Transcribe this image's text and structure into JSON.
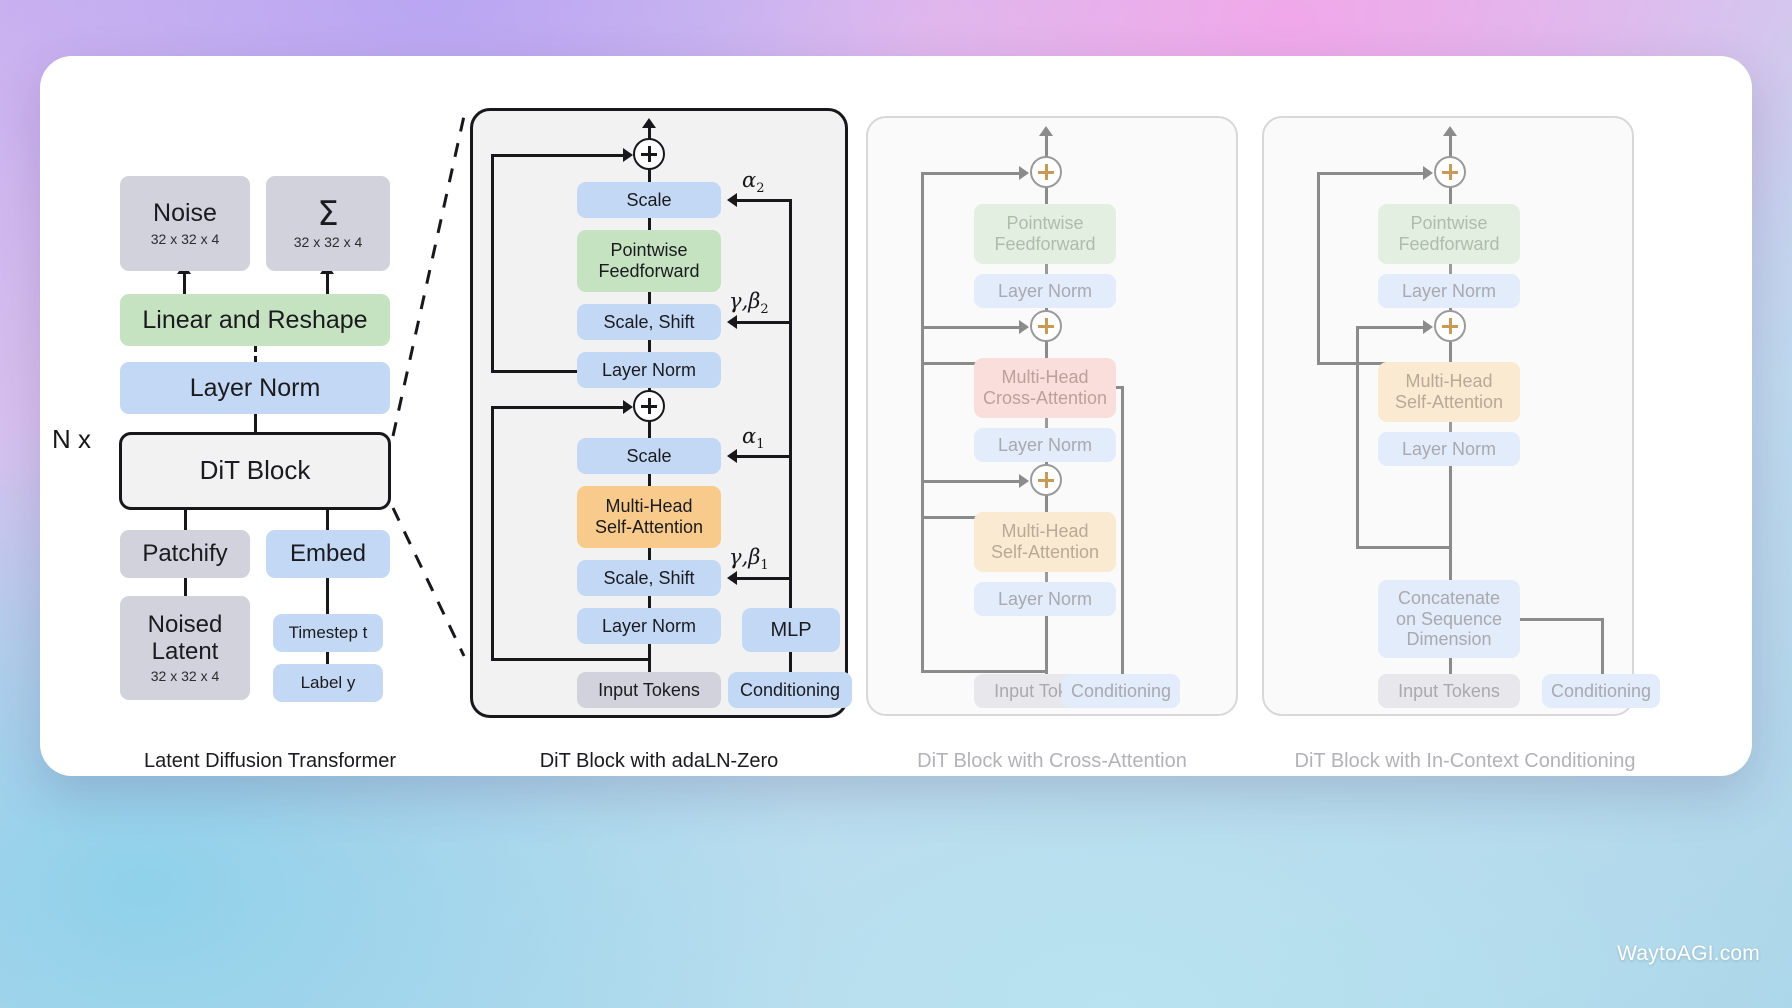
{
  "watermark": "WaytoAGI.com",
  "colors": {
    "grey": "#d2d2dc",
    "blue": "#c3d8f5",
    "green": "#c5e3c0",
    "orange": "#f8cb8c",
    "red": "#f6c8c4",
    "outline": "#18181c",
    "faded_text": "#a9a9b0"
  },
  "panels": [
    {
      "id": "latent-diffusion-transformer",
      "caption": "Latent Diffusion Transformer",
      "repeat_label": "N x",
      "nodes": {
        "noise": "Noise",
        "noise_shape": "32 x 32 x 4",
        "sigma": "Σ",
        "sigma_shape": "32 x 32 x 4",
        "linear_reshape": "Linear and Reshape",
        "layer_norm": "Layer Norm",
        "dit_block": "DiT Block",
        "patchify": "Patchify",
        "embed": "Embed",
        "noised_latent_l1": "Noised",
        "noised_latent_l2": "Latent",
        "noised_latent_shape": "32 x 32 x 4",
        "timestep": "Timestep t",
        "label": "Label y"
      }
    },
    {
      "id": "dit-block-adaln-zero",
      "caption": "DiT Block with adaLN-Zero",
      "nodes": {
        "scale2": "Scale",
        "pointwise_l1": "Pointwise",
        "pointwise_l2": "Feedforward",
        "scale_shift2": "Scale, Shift",
        "layer_norm2": "Layer Norm",
        "scale1": "Scale",
        "mhsa_l1": "Multi-Head",
        "mhsa_l2": "Self-Attention",
        "scale_shift1": "Scale, Shift",
        "layer_norm1": "Layer Norm",
        "mlp": "MLP",
        "input_tokens": "Input Tokens",
        "conditioning": "Conditioning"
      },
      "annotations": {
        "alpha2": "α",
        "alpha2_sub": "2",
        "gamma_beta2": "γ",
        "gamma_beta2_mid": ",β",
        "gamma_beta2_sub": "2",
        "alpha1": "α",
        "alpha1_sub": "1",
        "gamma_beta1": "γ",
        "gamma_beta1_mid": ",β",
        "gamma_beta1_sub": "1"
      }
    },
    {
      "id": "dit-block-cross-attention",
      "caption": "DiT Block with Cross-Attention",
      "nodes": {
        "pointwise_l1": "Pointwise",
        "pointwise_l2": "Feedforward",
        "layer_norm3": "Layer Norm",
        "mhca_l1": "Multi-Head",
        "mhca_l2": "Cross-Attention",
        "layer_norm2": "Layer Norm",
        "mhsa_l1": "Multi-Head",
        "mhsa_l2": "Self-Attention",
        "layer_norm1": "Layer Norm",
        "input_tokens": "Input Tokens",
        "conditioning": "Conditioning"
      }
    },
    {
      "id": "dit-block-in-context-conditioning",
      "caption": "DiT Block with In-Context Conditioning",
      "nodes": {
        "pointwise_l1": "Pointwise",
        "pointwise_l2": "Feedforward",
        "layer_norm2": "Layer Norm",
        "mhsa_l1": "Multi-Head",
        "mhsa_l2": "Self-Attention",
        "layer_norm1": "Layer Norm",
        "concat_l1": "Concatenate",
        "concat_l2": "on Sequence",
        "concat_l3": "Dimension",
        "input_tokens": "Input Tokens",
        "conditioning": "Conditioning"
      }
    }
  ]
}
